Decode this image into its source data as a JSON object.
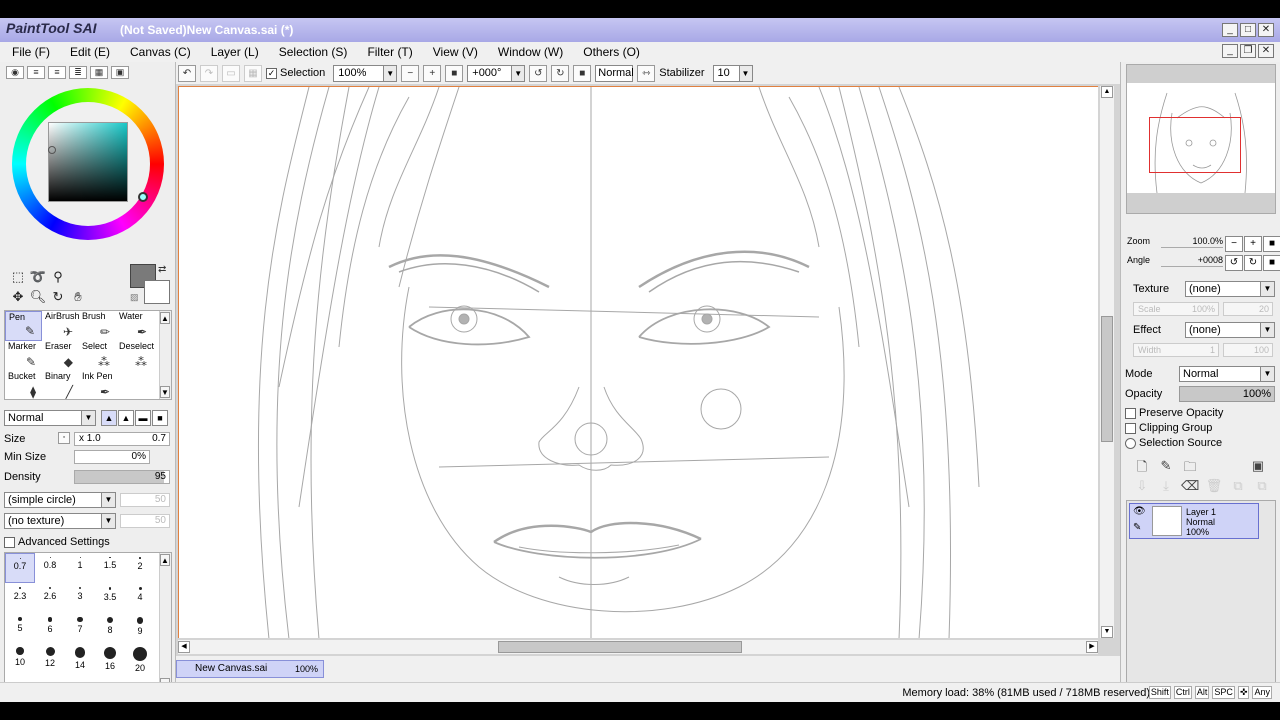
{
  "app": {
    "logo": "PaintTool SAI",
    "title": "(Not Saved)New Canvas.sai (*)"
  },
  "menu": [
    "File (F)",
    "Edit (E)",
    "Canvas (C)",
    "Layer (L)",
    "Selection (S)",
    "Filter (T)",
    "View (V)",
    "Window (W)",
    "Others (O)"
  ],
  "toolbar": {
    "selection_label": "Selection",
    "selection_checked": true,
    "zoom_value": "100%",
    "angle_value": "+000°",
    "blend_mode": "Normal",
    "stabilizer_label": "Stabilizer",
    "stabilizer_value": "10"
  },
  "color": {
    "main_color": "#7a7a7a",
    "sub_color": "#ffffff",
    "hue_color": "#18c8c8"
  },
  "tools": [
    {
      "label": "Pen",
      "icon": "pen-icon",
      "glyph": "✎",
      "active": true
    },
    {
      "label": "AirBrush",
      "icon": "airbrush-icon",
      "glyph": "✈",
      "active": false
    },
    {
      "label": "Brush",
      "icon": "brush-icon",
      "glyph": "✏",
      "active": false
    },
    {
      "label": "Water",
      "icon": "water-icon",
      "glyph": "✒",
      "active": false
    },
    {
      "label": "Marker",
      "icon": "marker-icon",
      "glyph": "✎",
      "active": false
    },
    {
      "label": "Eraser",
      "icon": "eraser-icon",
      "glyph": "◆",
      "active": false
    },
    {
      "label": "Select",
      "icon": "select-icon",
      "glyph": "⁂",
      "active": false
    },
    {
      "label": "Deselect",
      "icon": "deselect-icon",
      "glyph": "⁂",
      "active": false
    },
    {
      "label": "Bucket",
      "icon": "bucket-icon",
      "glyph": "⧫",
      "active": false
    },
    {
      "label": "Binary",
      "icon": "binary-icon",
      "glyph": "╱",
      "active": false
    },
    {
      "label": "Ink Pen",
      "icon": "ink-pen-icon",
      "glyph": "✒",
      "active": false
    }
  ],
  "brush": {
    "mode": "Normal",
    "size_label": "Size",
    "size_multiplier": "x 1.0",
    "size_value": "0.7",
    "min_size_label": "Min Size",
    "min_size_value": "0%",
    "density_label": "Density",
    "density_value": "95",
    "shape": "(simple circle)",
    "shape_strength": "50",
    "texture": "(no texture)",
    "texture_strength": "50",
    "advanced_label": "Advanced Settings"
  },
  "brush_sizes": [
    "0.7",
    "0.8",
    "1",
    "1.5",
    "2",
    "2.3",
    "2.6",
    "3",
    "3.5",
    "4",
    "5",
    "6",
    "7",
    "8",
    "9",
    "10",
    "12",
    "14",
    "16",
    "20"
  ],
  "file_tab": {
    "name": "New Canvas.sai",
    "zoom": "100%"
  },
  "navigator": {
    "zoom_label": "Zoom",
    "zoom_value": "100.0%",
    "angle_label": "Angle",
    "angle_value": "+0008"
  },
  "layer_props": {
    "texture_label": "Texture",
    "texture_value": "(none)",
    "texture_scale": "Scale",
    "texture_scale_value": "100%",
    "texture_strength_value": "20",
    "effect_label": "Effect",
    "effect_value": "(none)",
    "effect_width": "Width",
    "effect_width_value": "1",
    "effect_strength_value": "100",
    "mode_label": "Mode",
    "mode_value": "Normal",
    "opacity_label": "Opacity",
    "opacity_value": "100%",
    "preserve_opacity": "Preserve Opacity",
    "clipping_group": "Clipping Group",
    "selection_source": "Selection Source"
  },
  "layers": [
    {
      "name": "Layer 1",
      "mode": "Normal",
      "opacity": "100%"
    }
  ],
  "status": {
    "memory": "Memory load: 38% (81MB used / 718MB reserved)",
    "keys": [
      "Shift",
      "Ctrl",
      "Alt",
      "SPC",
      "✜",
      "Any"
    ]
  }
}
